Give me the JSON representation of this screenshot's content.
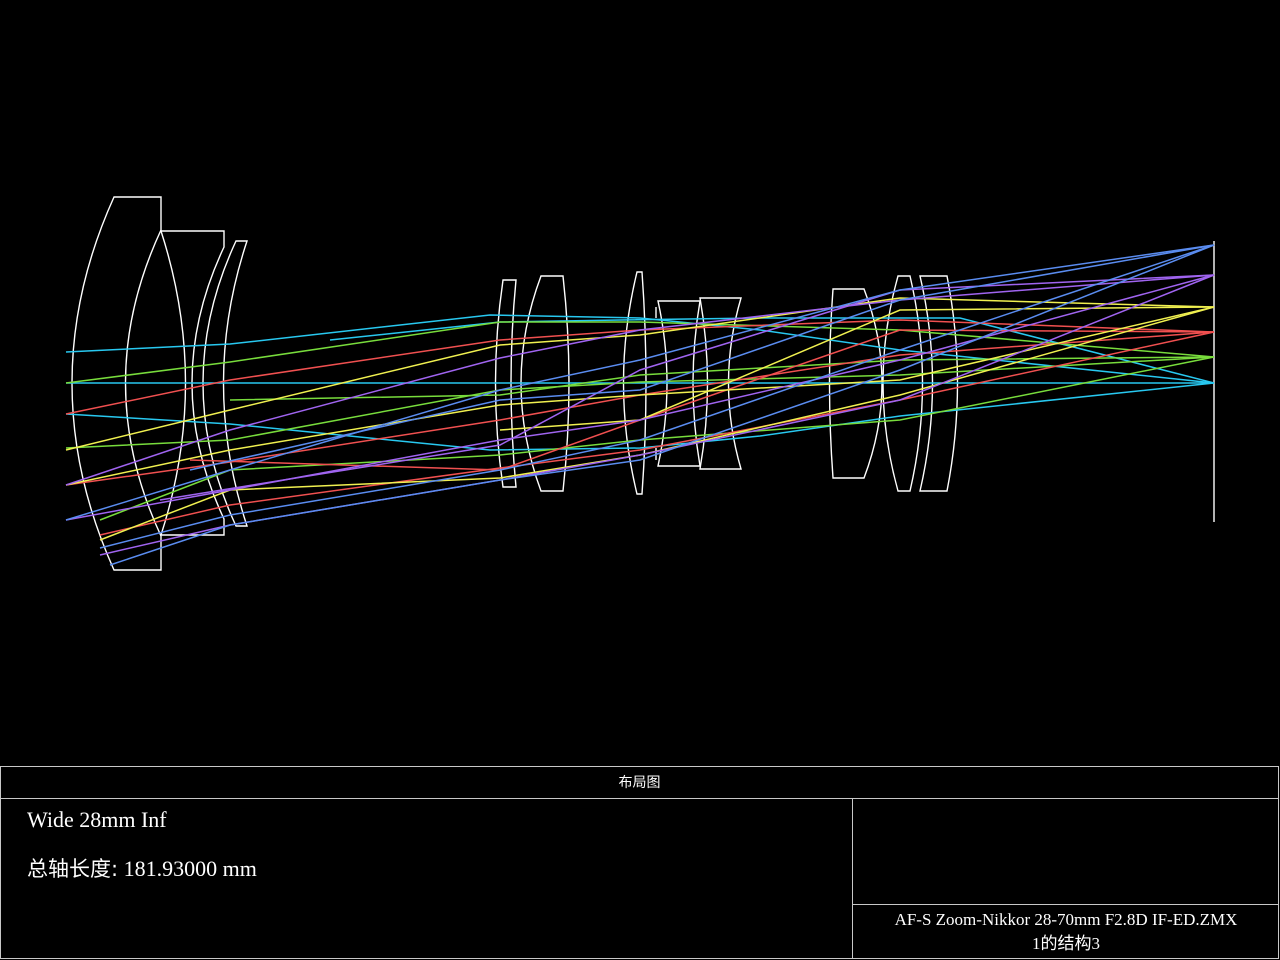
{
  "panel": {
    "title": "布局图",
    "config": "Wide 28mm Inf",
    "total_length_label": "总轴长度:",
    "total_length_value": "181.93000 mm",
    "file_name": "AF-S Zoom-Nikkor 28-70mm F2.8D IF-ED.ZMX",
    "config_info": "1的结构3"
  },
  "colors": {
    "background": "#000000",
    "lens_outline": "#ffffff",
    "field_1": "#28c8f0",
    "field_2": "#78dc3c",
    "field_3": "#f05050",
    "field_4": "#f0f050",
    "field_5": "#a064f0",
    "field_6": "#5a8cf0"
  }
}
